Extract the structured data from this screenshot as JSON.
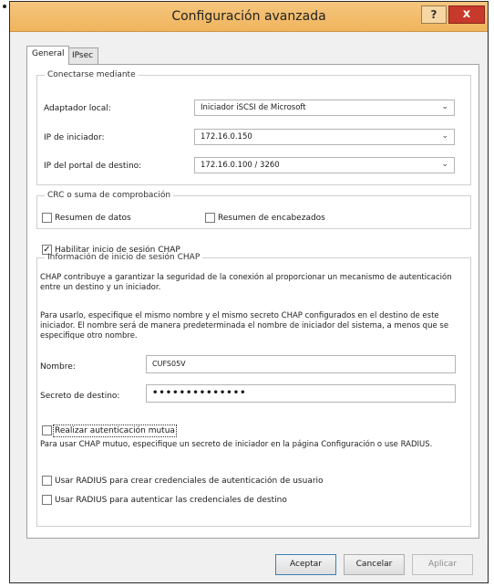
{
  "window": {
    "title": "Configuración avanzada",
    "help": "?",
    "close": "x"
  },
  "tabs": [
    "General",
    "IPsec"
  ],
  "connect": {
    "legend": "Conectarse mediante",
    "adapter_label": "Adaptador local:",
    "adapter_value": "Iniciador iSCSI de Microsoft",
    "initiator_ip_label": "IP de iniciador:",
    "initiator_ip_value": "172.16.0.150",
    "portal_ip_label": "IP del portal de destino:",
    "portal_ip_value": "172.16.0.100 / 3260"
  },
  "crc": {
    "legend": "CRC o suma de comprobación",
    "data_digest": "Resumen de datos",
    "header_digest": "Resumen de encabezados"
  },
  "chap": {
    "enable_label": "Habilitar inicio de sesión CHAP",
    "legend": "Información de inicio de sesión CHAP",
    "para1": "CHAP contribuye a garantizar la seguridad de la conexión al proporcionar un mecanismo de autenticación entre un destino y un iniciador.",
    "para2": "Para usarlo, especifique el mismo nombre y el mismo secreto CHAP configurados en el destino de este iniciador. El nombre será de manera predeterminada el nombre de iniciador del sistema, a menos que se especifique otro nombre.",
    "name_label": "Nombre:",
    "name_value": "CUFS05V",
    "secret_label": "Secreto de destino:",
    "secret_value": "••••••••••••••"
  },
  "mutual": {
    "label": "Realizar autenticación mutua",
    "para": "Para usar CHAP mutuo, especifique un secreto de iniciador en la página Configuración o use RADIUS."
  },
  "radius": {
    "user_creds": "Usar RADIUS para crear credenciales de autenticación de usuario",
    "target_creds": "Usar RADIUS para autenticar las credenciales de destino"
  },
  "buttons": {
    "ok": "Aceptar",
    "cancel": "Cancelar",
    "apply": "Aplicar"
  }
}
